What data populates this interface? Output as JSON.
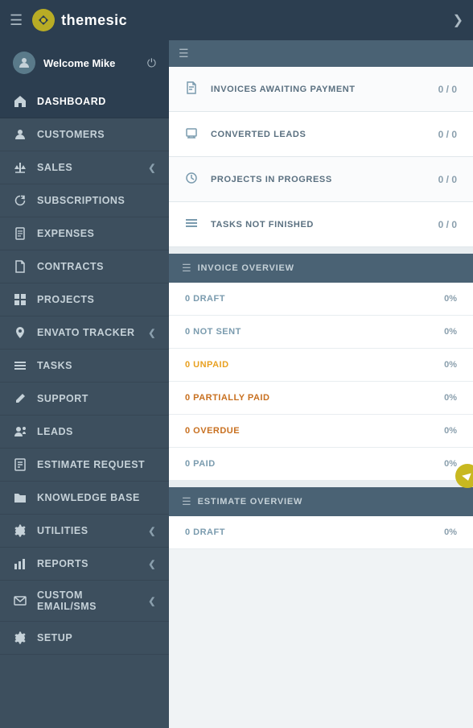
{
  "topbar": {
    "hamburger_label": "☰",
    "logo_text": "themesic",
    "chevron": "❯"
  },
  "user": {
    "welcome_text": "Welcome Mike",
    "power_icon": "⏻"
  },
  "sidebar": {
    "items": [
      {
        "id": "dashboard",
        "label": "DASHBOARD",
        "icon": "house",
        "active": true,
        "has_chevron": false
      },
      {
        "id": "customers",
        "label": "CUSTOMERS",
        "icon": "person",
        "active": false,
        "has_chevron": false
      },
      {
        "id": "sales",
        "label": "SALES",
        "icon": "scale",
        "active": false,
        "has_chevron": true
      },
      {
        "id": "subscriptions",
        "label": "SUBSCRIPTIONS",
        "icon": "refresh",
        "active": false,
        "has_chevron": false
      },
      {
        "id": "expenses",
        "label": "EXPENSES",
        "icon": "doc",
        "active": false,
        "has_chevron": false
      },
      {
        "id": "contracts",
        "label": "CONTRACTS",
        "icon": "file",
        "active": false,
        "has_chevron": false
      },
      {
        "id": "projects",
        "label": "PROJECTS",
        "icon": "grid",
        "active": false,
        "has_chevron": false
      },
      {
        "id": "envato-tracker",
        "label": "ENVATO TRACKER",
        "icon": "location",
        "active": false,
        "has_chevron": true
      },
      {
        "id": "tasks",
        "label": "TASKS",
        "icon": "list",
        "active": false,
        "has_chevron": false
      },
      {
        "id": "support",
        "label": "SUPPORT",
        "icon": "pencil",
        "active": false,
        "has_chevron": false
      },
      {
        "id": "leads",
        "label": "LEADS",
        "icon": "person2",
        "active": false,
        "has_chevron": false
      },
      {
        "id": "estimate-request",
        "label": "ESTIMATE REQUEST",
        "icon": "doc2",
        "active": false,
        "has_chevron": false
      },
      {
        "id": "knowledge-base",
        "label": "KNOWLEDGE BASE",
        "icon": "folder",
        "active": false,
        "has_chevron": false
      },
      {
        "id": "utilities",
        "label": "UTILITIES",
        "icon": "gear",
        "active": false,
        "has_chevron": true
      },
      {
        "id": "reports",
        "label": "REPORTS",
        "icon": "chart",
        "active": false,
        "has_chevron": true
      },
      {
        "id": "custom-email",
        "label": "CUSTOM EMAIL/SMS",
        "icon": "envelope",
        "active": false,
        "has_chevron": true
      },
      {
        "id": "setup",
        "label": "SETUP",
        "icon": "gear2",
        "active": false,
        "has_chevron": false
      }
    ]
  },
  "stats": [
    {
      "label": "INVOICES AWAITING PAYMENT",
      "value": "0 / 0",
      "icon": "⚖"
    },
    {
      "label": "CONVERTED LEADS",
      "value": "0 / 0",
      "icon": "🖥"
    },
    {
      "label": "PROJECTS IN PROGRESS",
      "value": "0 / 0",
      "icon": "🔧"
    },
    {
      "label": "TASKS NOT FINISHED",
      "value": "0 / 0",
      "icon": "☰"
    }
  ],
  "invoice_overview": {
    "title": "INVOICE OVERVIEW",
    "items": [
      {
        "label": "0 DRAFT",
        "percent": "0%",
        "color": "normal"
      },
      {
        "label": "0 NOT SENT",
        "percent": "0%",
        "color": "normal"
      },
      {
        "label": "0 UNPAID",
        "percent": "0%",
        "color": "orange"
      },
      {
        "label": "0 PARTIALLY PAID",
        "percent": "0%",
        "color": "amber"
      },
      {
        "label": "0 OVERDUE",
        "percent": "0%",
        "color": "amber"
      },
      {
        "label": "0 PAID",
        "percent": "0%",
        "color": "normal"
      }
    ]
  },
  "estimate_overview": {
    "title": "ESTIMATE OVERVIEW",
    "items": [
      {
        "label": "0 DRAFT",
        "percent": "0%",
        "color": "normal"
      }
    ]
  }
}
